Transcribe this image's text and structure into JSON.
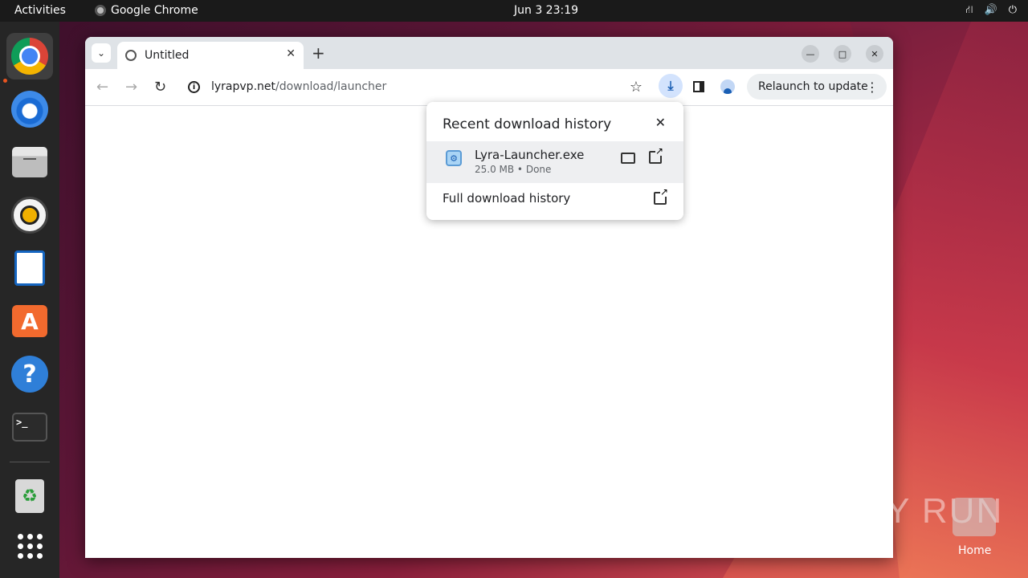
{
  "topbar": {
    "activities": "Activities",
    "app_name": "Google Chrome",
    "clock": "Jun 3  23:19"
  },
  "dock": {
    "items": [
      "chrome-icon",
      "thunderbird-icon",
      "files-icon",
      "rhythmbox-icon",
      "writer-icon",
      "app-center-icon",
      "help-icon",
      "terminal-icon",
      "trash-icon",
      "show-apps-icon"
    ]
  },
  "browser": {
    "tab_title": "Untitled",
    "url_host": "lyrapvp.net",
    "url_path": "/download/launcher",
    "relaunch_label": "Relaunch to update"
  },
  "downloads": {
    "title": "Recent download history",
    "file_name": "Lyra-Launcher.exe",
    "file_status": "25.0 MB • Done",
    "full_history": "Full download history"
  },
  "desktop": {
    "watermark": "ANY RUN",
    "home_label": "Home"
  },
  "colors": {
    "accent": "#e95420",
    "download_active": "#d3e3fd"
  }
}
